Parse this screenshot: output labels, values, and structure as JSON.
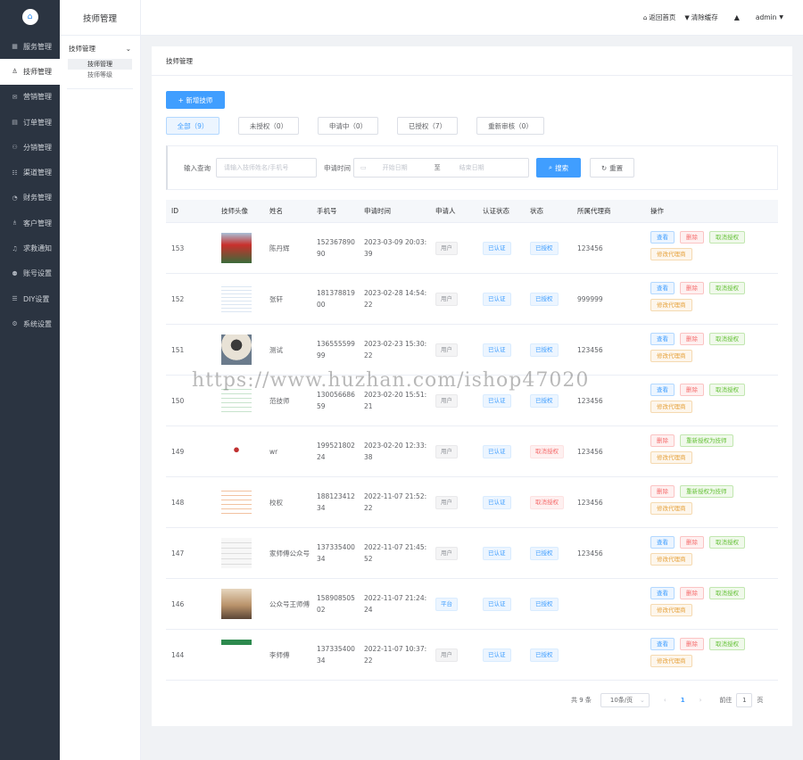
{
  "nav": {
    "logo_icon": "home-icon",
    "items": [
      {
        "label": "服务管理",
        "icon": "grid-icon"
      },
      {
        "label": "技师管理",
        "icon": "user-icon"
      },
      {
        "label": "营销管理",
        "icon": "gift-icon"
      },
      {
        "label": "订单管理",
        "icon": "clipboard-icon"
      },
      {
        "label": "分销管理",
        "icon": "share-icon"
      },
      {
        "label": "渠道管理",
        "icon": "channel-icon"
      },
      {
        "label": "财务管理",
        "icon": "pie-icon"
      },
      {
        "label": "客户管理",
        "icon": "people-icon"
      },
      {
        "label": "求救通知",
        "icon": "bell-icon"
      },
      {
        "label": "账号设置",
        "icon": "account-icon"
      },
      {
        "label": "DIY设置",
        "icon": "diy-icon"
      },
      {
        "label": "系统设置",
        "icon": "gear-icon"
      }
    ],
    "active_index": 1
  },
  "subnav": {
    "title": "技师管理",
    "group": "技师管理",
    "items": [
      "技师管理",
      "技师等级"
    ]
  },
  "topbar": {
    "home": "返回首页",
    "clear": "清除缓存",
    "user": "admin"
  },
  "card": {
    "breadcrumb": "技师管理",
    "add_button": "+ 新增技师",
    "tabs": [
      "全部（9）",
      "未授权（0）",
      "申请中（0）",
      "已授权（7）",
      "重新审核（0）"
    ],
    "filter": {
      "query_label": "输入查询",
      "query_placeholder": "请输入技师姓名/手机号",
      "time_label": "申请时间",
      "start_placeholder": "开始日期",
      "to": "至",
      "end_placeholder": "结束日期",
      "search": "搜索",
      "reset": "重置"
    }
  },
  "table": {
    "headers": [
      "ID",
      "技师头像",
      "姓名",
      "手机号",
      "申请时间",
      "申请人",
      "认证状态",
      "状态",
      "所属代理商",
      "操作"
    ],
    "rows": [
      {
        "id": "153",
        "name": "陈丹辉",
        "phone": "152367890 90",
        "time": "2023-03-09 20:03:39",
        "applicant": "用户",
        "cert": "已认证",
        "status": "已授权",
        "agent": "123456",
        "ops": [
          "查看",
          "删除",
          "取消授权",
          "修改代理商"
        ]
      },
      {
        "id": "152",
        "name": "张轩",
        "phone": "181378819 00",
        "time": "2023-02-28 14:54:22",
        "applicant": "用户",
        "cert": "已认证",
        "status": "已授权",
        "agent": "999999",
        "ops": [
          "查看",
          "删除",
          "取消授权",
          "修改代理商"
        ]
      },
      {
        "id": "151",
        "name": "测试",
        "phone": "136555599 99",
        "time": "2023-02-23 15:30:22",
        "applicant": "用户",
        "cert": "已认证",
        "status": "已授权",
        "agent": "123456",
        "ops": [
          "查看",
          "删除",
          "取消授权",
          "修改代理商"
        ]
      },
      {
        "id": "150",
        "name": "范技师",
        "phone": "130056686 59",
        "time": "2023-02-20 15:51:21",
        "applicant": "用户",
        "cert": "已认证",
        "status": "已授权",
        "agent": "123456",
        "ops": [
          "查看",
          "删除",
          "取消授权",
          "修改代理商"
        ]
      },
      {
        "id": "149",
        "name": "wr",
        "phone": "199521802 24",
        "time": "2023-02-20 12:33:38",
        "applicant": "用户",
        "cert": "已认证",
        "status": "取消授权",
        "agent": "123456",
        "ops": [
          "删除",
          "重新授权为技师",
          "修改代理商"
        ]
      },
      {
        "id": "148",
        "name": "校权",
        "phone": "188123412 34",
        "time": "2022-11-07 21:52:22",
        "applicant": "用户",
        "cert": "已认证",
        "status": "取消授权",
        "agent": "123456",
        "ops": [
          "删除",
          "重新授权为技师",
          "修改代理商"
        ]
      },
      {
        "id": "147",
        "name": "家师傅公众号",
        "phone": "137335400 34",
        "time": "2022-11-07 21:45:52",
        "applicant": "用户",
        "cert": "已认证",
        "status": "已授权",
        "agent": "123456",
        "ops": [
          "查看",
          "删除",
          "取消授权",
          "修改代理商"
        ]
      },
      {
        "id": "146",
        "name": "公众号王师傅",
        "phone": "158908505 02",
        "time": "2022-11-07 21:24:24",
        "applicant": "平台",
        "cert": "已认证",
        "status": "已授权",
        "agent": "",
        "ops": [
          "查看",
          "删除",
          "取消授权",
          "修改代理商"
        ]
      },
      {
        "id": "144",
        "name": "李师傅",
        "phone": "137335400 34",
        "time": "2022-11-07 10:37:22",
        "applicant": "用户",
        "cert": "已认证",
        "status": "已授权",
        "agent": "",
        "ops": [
          "查看",
          "删除",
          "取消授权",
          "修改代理商"
        ]
      }
    ]
  },
  "pager": {
    "total": "共 9 条",
    "size": "10条/页",
    "current": "1",
    "goto": "前往",
    "goto_value": "1",
    "page_unit": "页"
  },
  "watermark": "https://www.huzhan.com/ishop47020",
  "colors": {
    "primary": "#409eff",
    "nav_bg": "#2b3441",
    "danger": "#f56c6c",
    "success": "#67c23a",
    "warning": "#e6a23c"
  }
}
